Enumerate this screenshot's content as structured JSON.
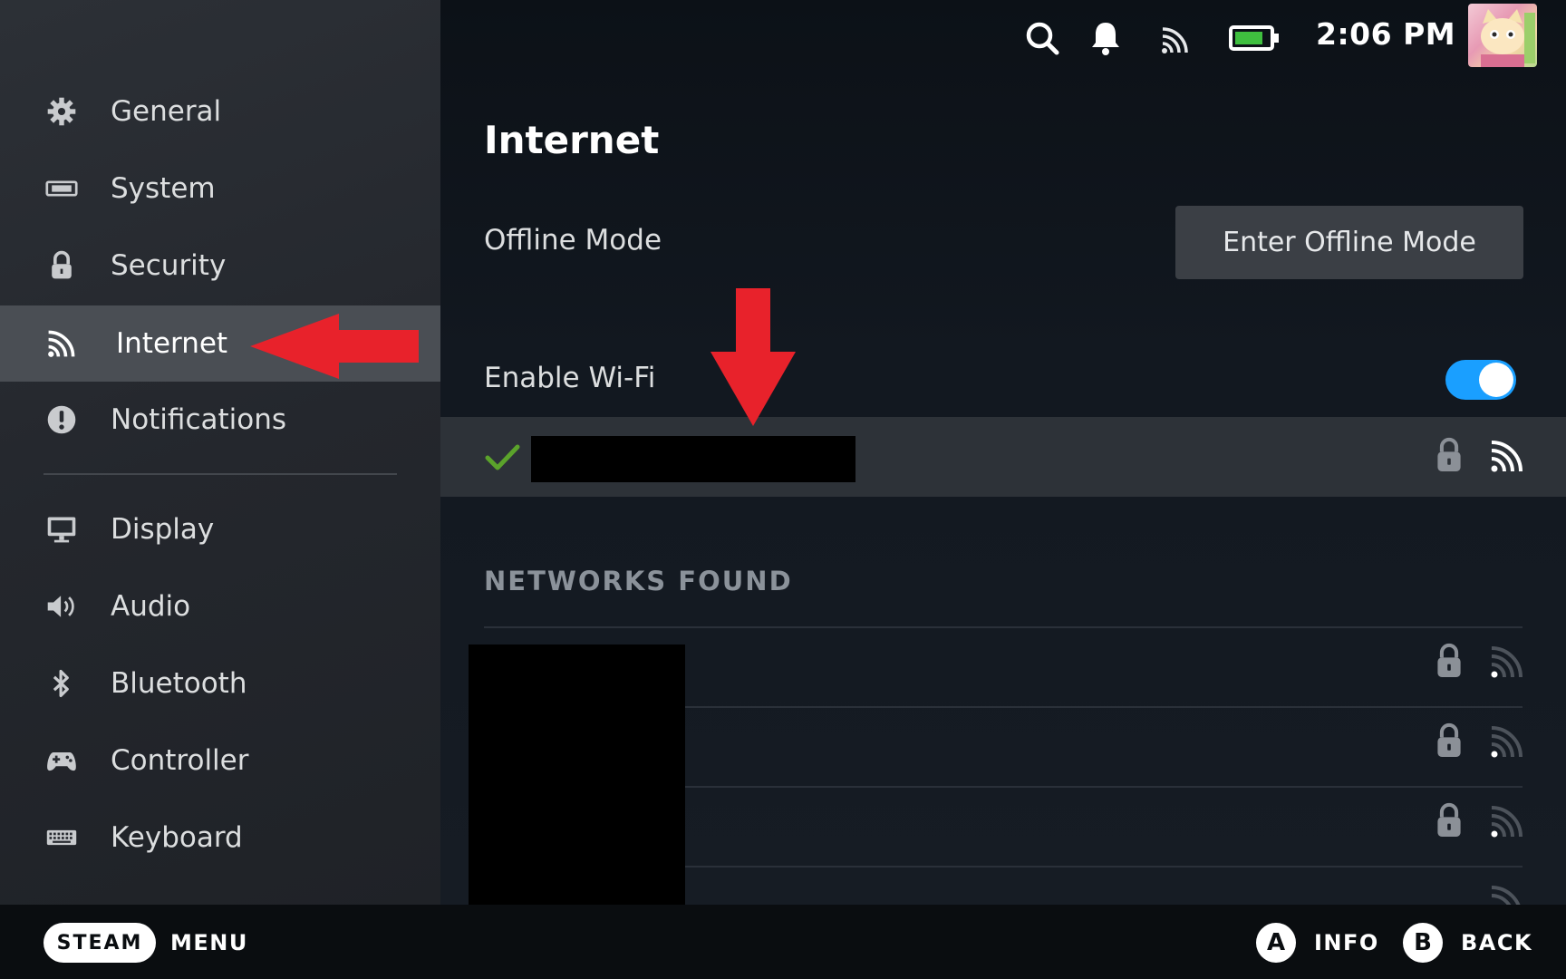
{
  "status_bar": {
    "time": "2:06 PM",
    "icons": [
      "search-icon",
      "bell-icon",
      "wifi-icon",
      "battery-icon",
      "avatar"
    ]
  },
  "sidebar": {
    "items": [
      {
        "label": "General",
        "icon": "gear-icon"
      },
      {
        "label": "System",
        "icon": "system-icon"
      },
      {
        "label": "Security",
        "icon": "lock-icon"
      },
      {
        "label": "Internet",
        "icon": "wifi-icon",
        "active": true
      },
      {
        "label": "Notifications",
        "icon": "alert-icon"
      },
      {
        "label": "Display",
        "icon": "monitor-icon"
      },
      {
        "label": "Audio",
        "icon": "speaker-icon"
      },
      {
        "label": "Bluetooth",
        "icon": "bluetooth-icon"
      },
      {
        "label": "Controller",
        "icon": "gamepad-icon"
      },
      {
        "label": "Keyboard",
        "icon": "keyboard-icon"
      }
    ]
  },
  "main": {
    "title": "Internet",
    "offline_mode": {
      "label": "Offline Mode",
      "button": "Enter Offline Mode"
    },
    "wifi": {
      "label": "Enable Wi-Fi",
      "enabled": true
    },
    "connected_network": {
      "status_icon": "checkmark-icon",
      "name_redacted": true
    },
    "networks_found": {
      "title": "NETWORKS FOUND",
      "count_visible_rows": 4
    }
  },
  "bottom_bar": {
    "steam_button": "STEAM",
    "menu_label": "MENU",
    "a_button": "A",
    "a_label": "INFO",
    "b_button": "B",
    "b_label": "BACK"
  },
  "colors": {
    "accent_toggle": "#1a9fff",
    "annotation_arrow": "#e8222b",
    "check_green": "#5ba32b"
  }
}
